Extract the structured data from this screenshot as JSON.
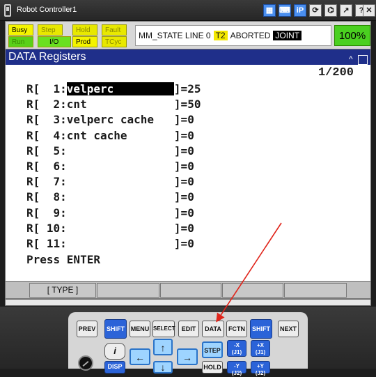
{
  "window": {
    "title": "Robot Controller1",
    "toolbar_icons": [
      "menu-grid-icon",
      "keyboard-icon",
      "ip-icon",
      "refresh-icon",
      "tool-icon",
      "resize-icon",
      "help-icon",
      "close-icon"
    ],
    "toolbar_labels": [
      "▦",
      "⌨",
      "iP",
      "⟳",
      "⌬",
      "↗",
      "?",
      "✕"
    ]
  },
  "status": {
    "leds_top": [
      "Busy",
      "Step",
      "Hold",
      "Fault"
    ],
    "leds_bottom": [
      "Run",
      "I/O",
      "Prod",
      "TCyc"
    ],
    "state_prefix": "MM_STATE LINE 0",
    "state_t2": "T2",
    "state_aborted": "ABORTED",
    "state_joint": "JOINT",
    "override": "100%"
  },
  "screen": {
    "title": "DATA Registers",
    "page": "1/200",
    "registers": [
      {
        "label": "R[  1:",
        "comment": "velperc         ",
        "value": "]=25"
      },
      {
        "label": "R[  2:",
        "comment": "cnt             ",
        "value": "]=50"
      },
      {
        "label": "R[  3:",
        "comment": "velperc cache   ",
        "value": "]=0"
      },
      {
        "label": "R[  4:",
        "comment": "cnt cache       ",
        "value": "]=0"
      },
      {
        "label": "R[  5:",
        "comment": "                ",
        "value": "]=0"
      },
      {
        "label": "R[  6:",
        "comment": "                ",
        "value": "]=0"
      },
      {
        "label": "R[  7:",
        "comment": "                ",
        "value": "]=0"
      },
      {
        "label": "R[  8:",
        "comment": "                ",
        "value": "]=0"
      },
      {
        "label": "R[  9:",
        "comment": "                ",
        "value": "]=0"
      },
      {
        "label": "R[ 10:",
        "comment": "                ",
        "value": "]=0"
      },
      {
        "label": "R[ 11:",
        "comment": "                ",
        "value": "]=0"
      }
    ],
    "prompt": "Press ENTER",
    "fkeys": [
      "[ TYPE ]",
      "",
      "",
      "",
      ""
    ]
  },
  "pendant": {
    "row1": [
      "PREV",
      "SHIFT",
      "MENU",
      "SELECT",
      "EDIT",
      "DATA",
      "FCTN",
      "SHIFT",
      "NEXT"
    ],
    "row2": [
      "i",
      "←",
      "↑",
      "→",
      "STEP",
      "-X\n(J1)",
      "+X\n(J1)"
    ],
    "row3": [
      "DISP",
      "↓",
      "HOLD",
      "-Y\n(J2)",
      "+Y\n(J2)"
    ]
  },
  "annotation": {
    "color": "#e0241a"
  }
}
